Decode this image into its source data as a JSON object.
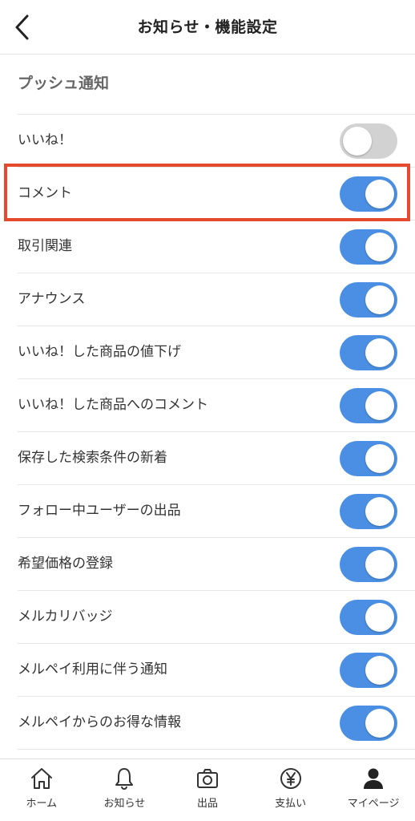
{
  "header": {
    "title": "お知らせ・機能設定",
    "back_icon": "chevron-left-icon"
  },
  "section": {
    "title": "プッシュ通知"
  },
  "settings": [
    {
      "label": "いいね！",
      "enabled": false
    },
    {
      "label": "コメント",
      "enabled": true
    },
    {
      "label": "取引関連",
      "enabled": true
    },
    {
      "label": "アナウンス",
      "enabled": true
    },
    {
      "label": "いいね！した商品の値下げ",
      "enabled": true
    },
    {
      "label": "いいね！した商品へのコメント",
      "enabled": true
    },
    {
      "label": "保存した検索条件の新着",
      "enabled": true
    },
    {
      "label": "フォロー中ユーザーの出品",
      "enabled": true
    },
    {
      "label": "希望価格の登録",
      "enabled": true
    },
    {
      "label": "メルカリバッジ",
      "enabled": true
    },
    {
      "label": "メルペイ利用に伴う通知",
      "enabled": true
    },
    {
      "label": "メルペイからのお得な情報",
      "enabled": true
    }
  ],
  "highlight": {
    "target": "コメント",
    "color": "#e54a2e"
  },
  "colors": {
    "toggle_on": "#4a8fe3",
    "toggle_off": "#d2d2d2"
  },
  "bottom_nav": {
    "items": [
      {
        "label": "ホーム",
        "icon": "home-icon"
      },
      {
        "label": "お知らせ",
        "icon": "bell-icon"
      },
      {
        "label": "出品",
        "icon": "camera-icon"
      },
      {
        "label": "支払い",
        "icon": "yen-icon"
      },
      {
        "label": "マイページ",
        "icon": "person-icon"
      }
    ]
  }
}
